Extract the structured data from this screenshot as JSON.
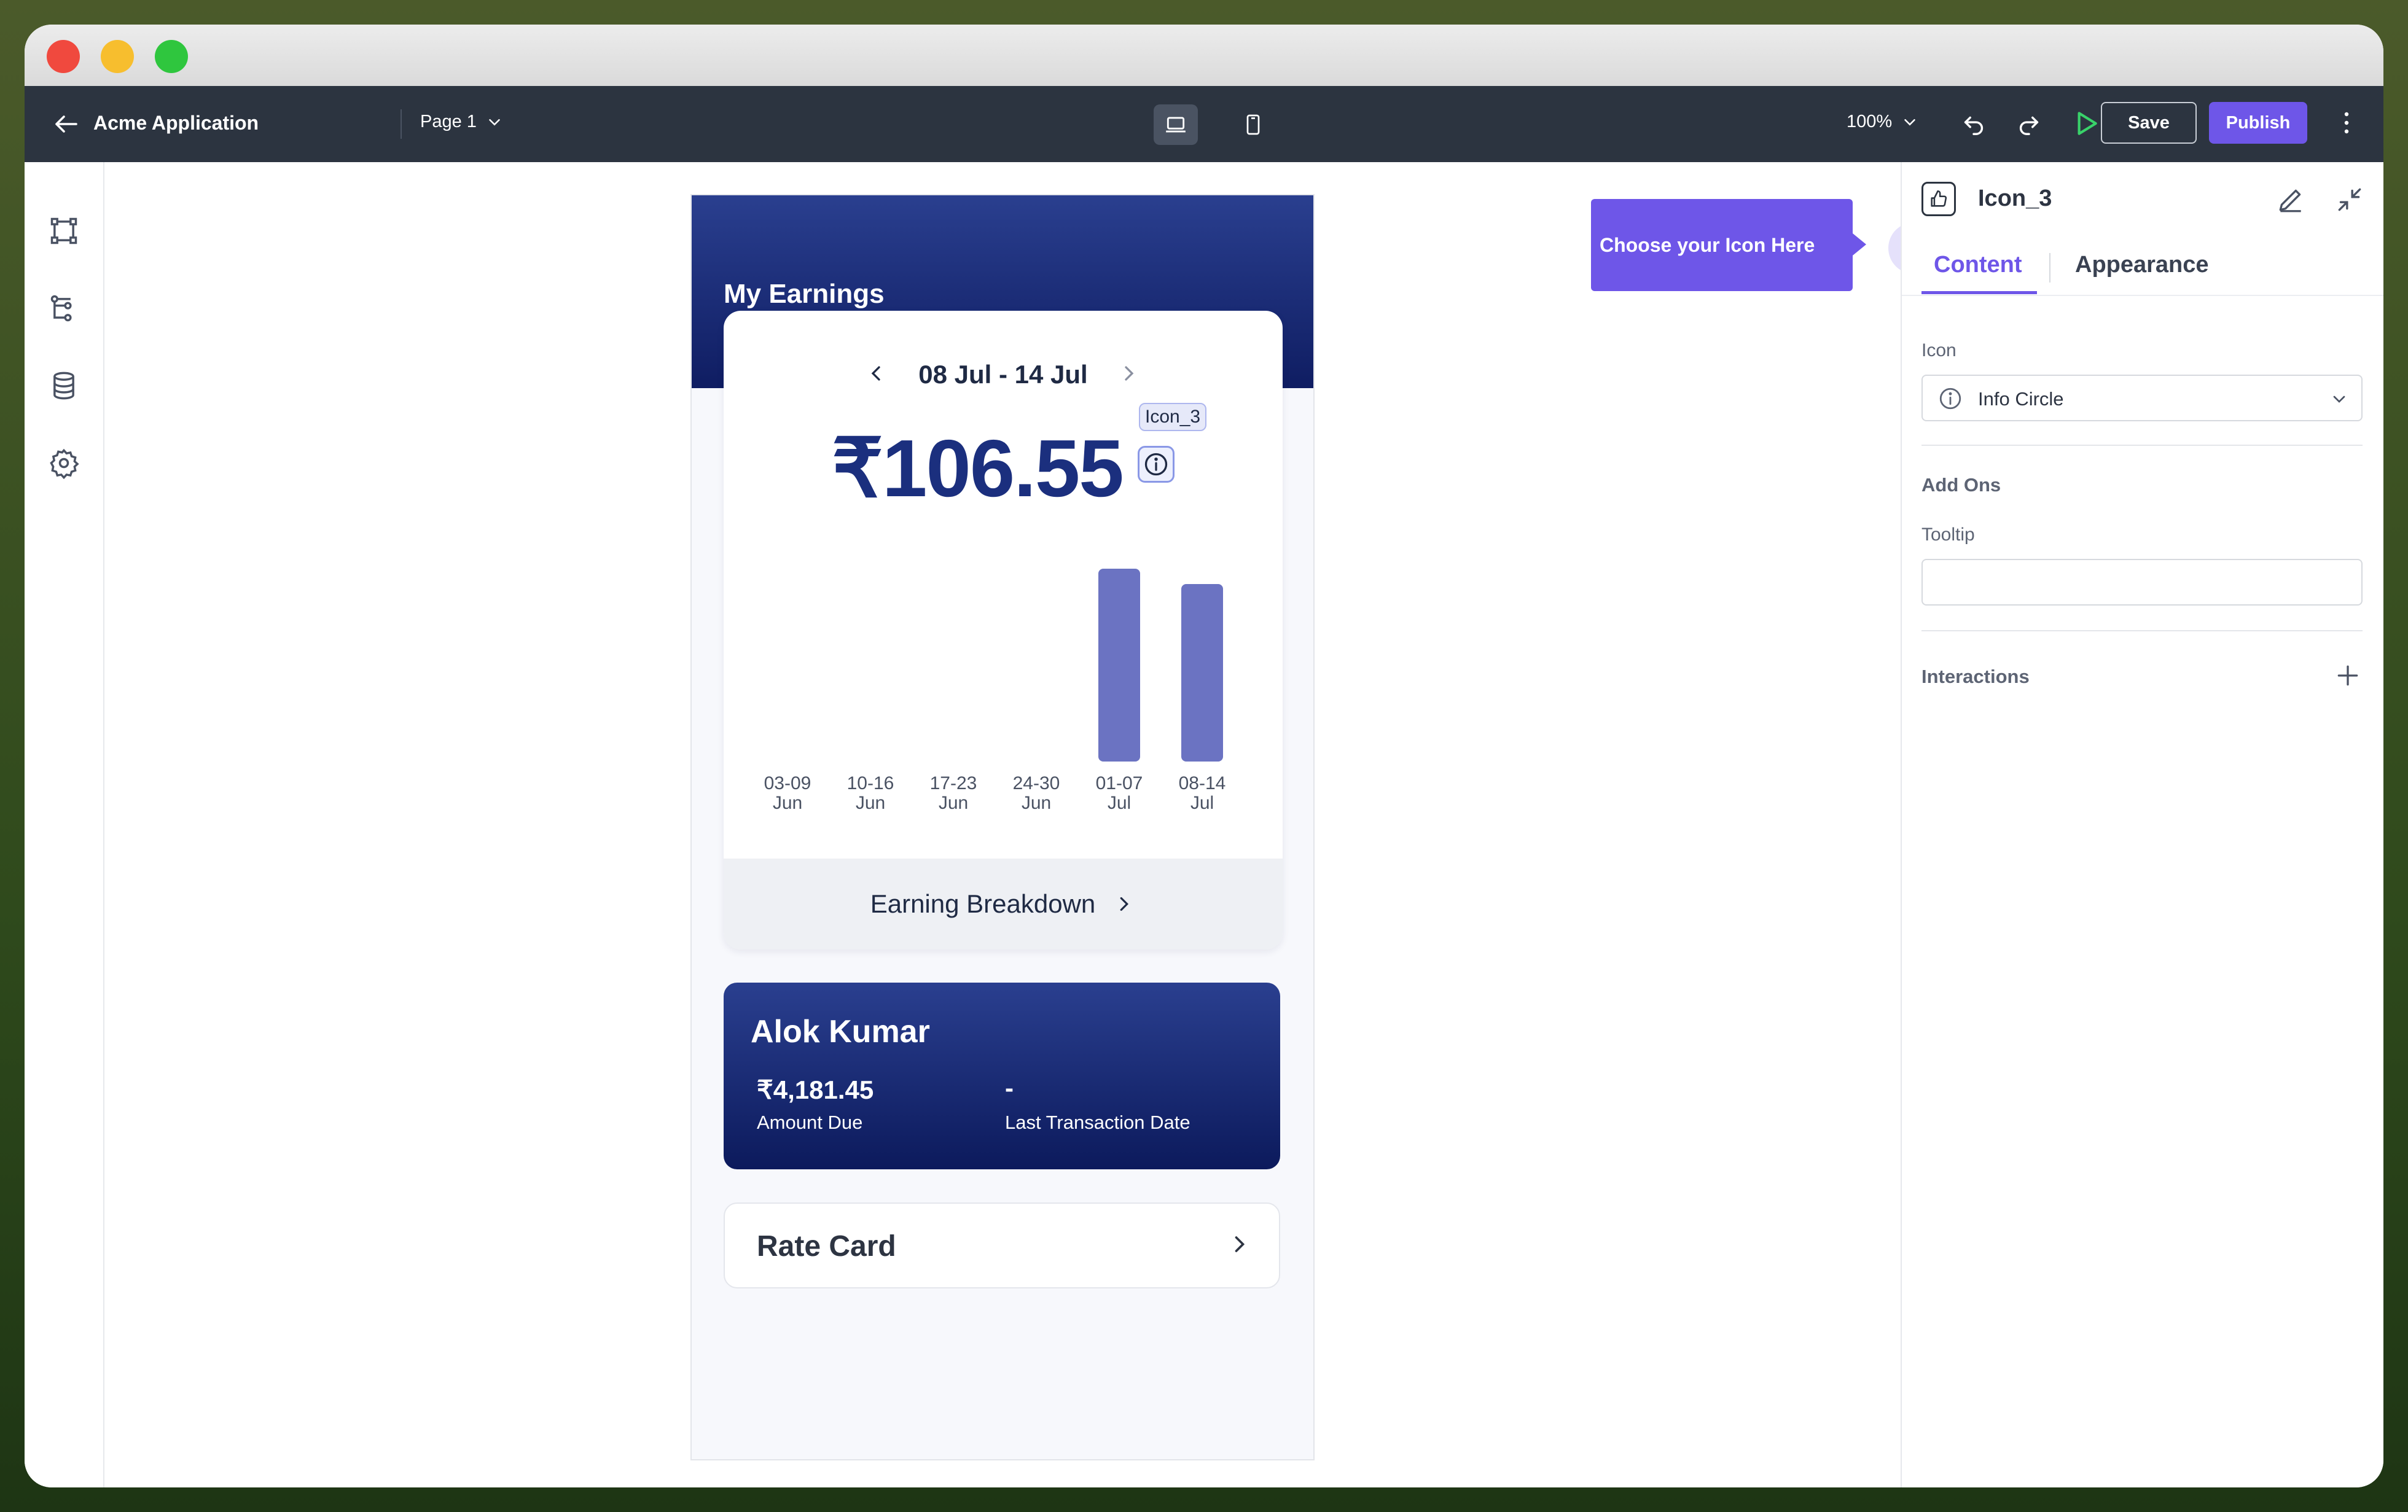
{
  "app": {
    "title": "Acme Application",
    "page": "Page 1",
    "zoom": "100%"
  },
  "toolbar": {
    "save_label": "Save",
    "publish_label": "Publish"
  },
  "canvas": {
    "header_title": "My Earnings",
    "date_range": "08 Jul - 14 Jul",
    "amount": "₹106.55",
    "selected_tag": "Icon_3",
    "breakdown_label": "Earning Breakdown",
    "user": {
      "name": "Alok Kumar",
      "amount_due_value": "₹4,181.45",
      "amount_due_label": "Amount Due",
      "last_txn_value": "-",
      "last_txn_label": "Last Transaction Date"
    },
    "rate_card_label": "Rate Card"
  },
  "chart_data": {
    "type": "bar",
    "categories": [
      {
        "line1": "03-09",
        "line2": "Jun"
      },
      {
        "line1": "10-16",
        "line2": "Jun"
      },
      {
        "line1": "17-23",
        "line2": "Jun"
      },
      {
        "line1": "24-30",
        "line2": "Jun"
      },
      {
        "line1": "01-07",
        "line2": "Jul"
      },
      {
        "line1": "08-14",
        "line2": "Jul"
      }
    ],
    "values": [
      0,
      0,
      0,
      0,
      1.0,
      0.92
    ],
    "color": "#6b73c2"
  },
  "tooltip_hint": "Choose your Icon Here",
  "right_panel": {
    "title": "Icon_3",
    "tabs": [
      "Content",
      "Appearance"
    ],
    "icon_label": "Icon",
    "icon_value": "Info Circle",
    "add_ons_label": "Add Ons",
    "tooltip_label": "Tooltip",
    "tooltip_value": "",
    "interactions_label": "Interactions"
  },
  "colors": {
    "accent": "#6e56e8",
    "navy": "#1b2f7e",
    "appbar": "#2c3440"
  }
}
